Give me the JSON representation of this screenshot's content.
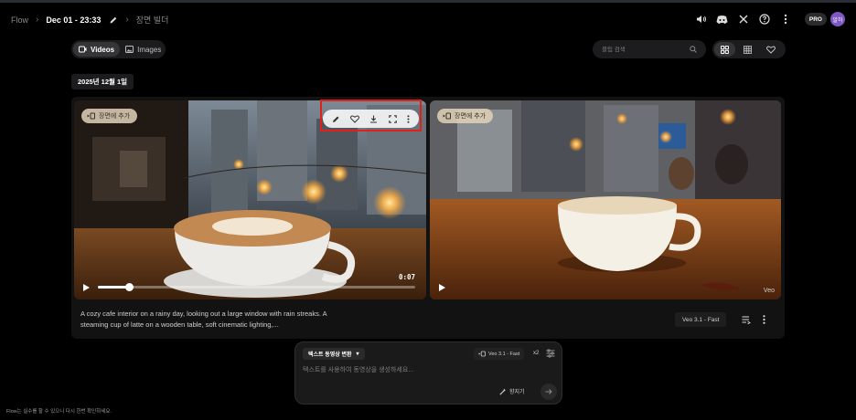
{
  "header": {
    "breadcrumb": [
      "Flow",
      "Dec 01 - 23:33",
      "장면 빌더"
    ],
    "right_icons": [
      "volume-icon",
      "discord-icon",
      "x-icon",
      "help-icon",
      "more-vert-icon"
    ],
    "plan_badge": "PRO",
    "avatar_initials": "알하"
  },
  "toolbar": {
    "tabs": [
      {
        "label": "Videos",
        "icon": "video-icon",
        "active": true
      },
      {
        "label": "Images",
        "icon": "image-icon",
        "active": false
      }
    ],
    "search_placeholder": "클립 검색",
    "view_buttons": [
      {
        "icon": "grid-large-icon",
        "active": true
      },
      {
        "icon": "grid-small-icon",
        "active": false
      },
      {
        "icon": "heart-icon",
        "active": false
      }
    ]
  },
  "date_group": "2025년 12월 1일",
  "clips": [
    {
      "add_to_scene": "장면에 추가",
      "hover_tools": [
        "edit-icon",
        "heart-icon",
        "download-icon",
        "fullscreen-icon",
        "more-vert-icon"
      ],
      "timecode": "0:07",
      "progress_fraction": 0.1
    },
    {
      "add_to_scene": "장면에 추가",
      "watermark": "Veo"
    }
  ],
  "prompt": "A cozy cafe interior on a rainy day, looking out a large window with rain streaks. A steaming cup of latte on a wooden table, soft cinematic lighting,...",
  "model_label": "Veo 3.1 - Fast",
  "composer": {
    "mode": "텍스트 동영상 변환",
    "model": "Veo 3.1 - Fast",
    "count": "x2",
    "placeholder": "텍스트를 사용하여 동영상을 생성하세요...",
    "refine_label": "향지기"
  },
  "disclaimer": "Flow는 실수를 할 수 있으니 다시 한번 확인하세요.",
  "colors": {
    "background": "#000000",
    "surface": "#1c1c1e",
    "highlight_box": "#e0201b",
    "avatar": "#7e57c2"
  }
}
